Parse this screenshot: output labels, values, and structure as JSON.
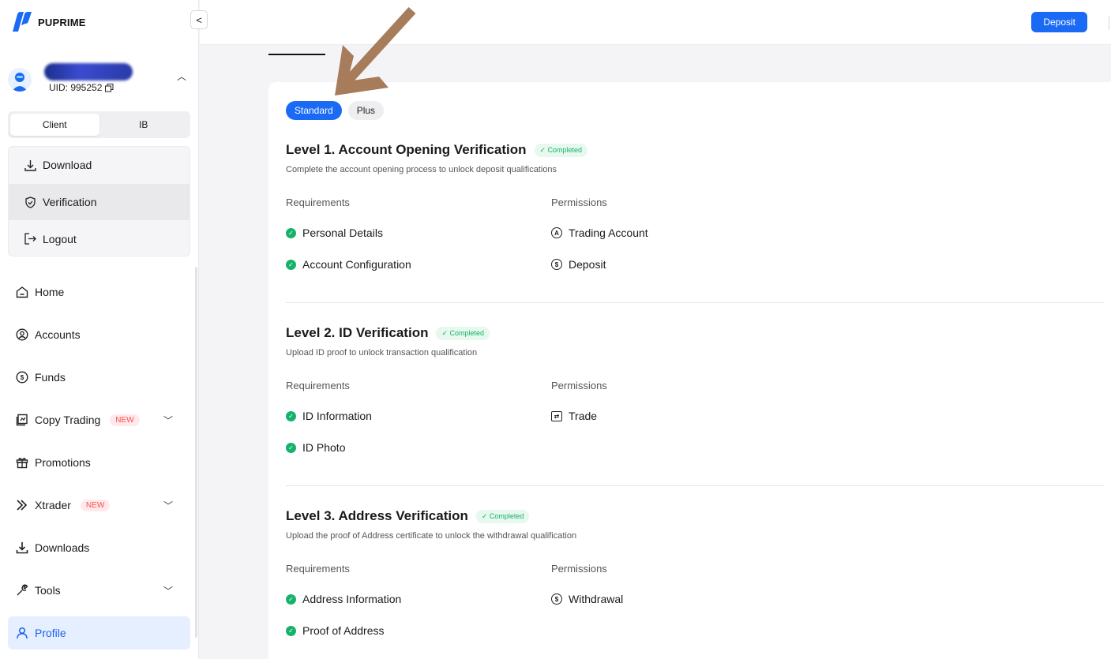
{
  "brand": {
    "name": "PUPRIME",
    "accent": "#1a6af5"
  },
  "user": {
    "uid": "UID: 995252"
  },
  "switch": {
    "client": "Client",
    "ib": "IB"
  },
  "account_menu": [
    {
      "label": "Download",
      "icon": "download-icon"
    },
    {
      "label": "Verification",
      "icon": "shield-check-icon"
    },
    {
      "label": "Logout",
      "icon": "logout-icon"
    }
  ],
  "nav": [
    {
      "label": "Home",
      "icon": "home-icon"
    },
    {
      "label": "Accounts",
      "icon": "accounts-icon"
    },
    {
      "label": "Funds",
      "icon": "funds-icon"
    },
    {
      "label": "Copy Trading",
      "icon": "copy-trading-icon",
      "badge": "NEW"
    },
    {
      "label": "Promotions",
      "icon": "gift-icon"
    },
    {
      "label": "Xtrader",
      "icon": "xtrader-icon",
      "badge": "NEW"
    },
    {
      "label": "Downloads",
      "icon": "download-icon"
    },
    {
      "label": "Tools",
      "icon": "wrench-icon"
    },
    {
      "label": "Profile",
      "icon": "profile-icon"
    }
  ],
  "topbar": {
    "deposit": "Deposit"
  },
  "tabs": {
    "standard": "Standard",
    "plus": "Plus"
  },
  "levels": [
    {
      "title": "Level 1. Account Opening Verification",
      "status": "✓ Completed",
      "desc": "Complete the account opening process to unlock deposit qualifications",
      "req_head": "Requirements",
      "perm_head": "Permissions",
      "requirements": [
        "Personal Details",
        "Account Configuration"
      ],
      "permissions": [
        "Trading Account",
        "Deposit"
      ]
    },
    {
      "title": "Level 2. ID Verification",
      "status": "✓ Completed",
      "desc": "Upload ID proof to unlock transaction qualification",
      "req_head": "Requirements",
      "perm_head": "Permissions",
      "requirements": [
        "ID Information",
        "ID Photo"
      ],
      "permissions": [
        "Trade"
      ]
    },
    {
      "title": "Level 3. Address Verification",
      "status": "✓ Completed",
      "desc": "Upload the proof of Address certificate to unlock the withdrawal qualification",
      "req_head": "Requirements",
      "perm_head": "Permissions",
      "requirements": [
        "Address Information",
        "Proof of Address"
      ],
      "permissions": [
        "Withdrawal"
      ]
    }
  ]
}
